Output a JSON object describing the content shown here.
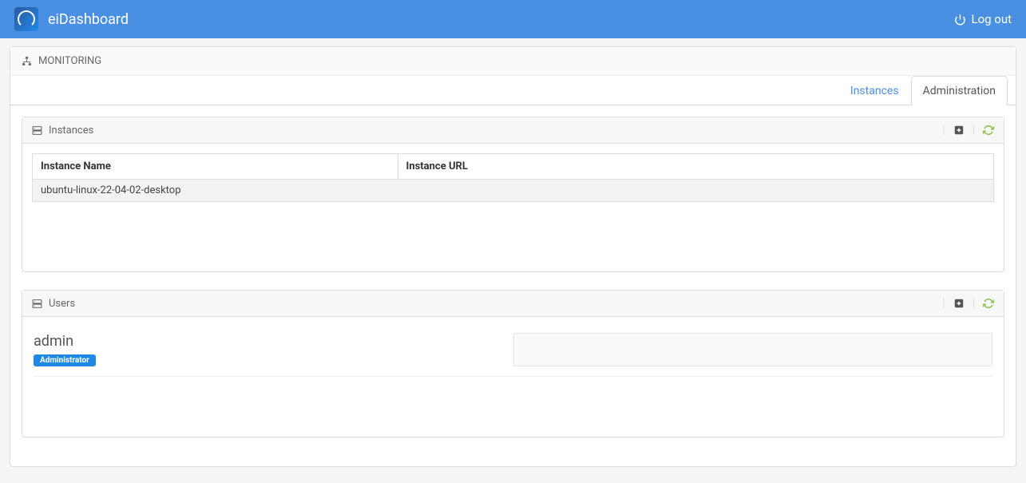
{
  "navbar": {
    "brand": "eiDashboard",
    "logout": "Log out"
  },
  "monitoring": {
    "title": "MONITORING",
    "tabs": {
      "instances": "Instances",
      "administration": "Administration"
    }
  },
  "instances_panel": {
    "title": "Instances",
    "columns": {
      "name": "Instance Name",
      "url": "Instance URL"
    },
    "rows": [
      {
        "name": "ubuntu-linux-22-04-02-desktop",
        "url": ""
      }
    ]
  },
  "users_panel": {
    "title": "Users",
    "users": [
      {
        "name": "admin",
        "role": "Administrator"
      }
    ]
  }
}
